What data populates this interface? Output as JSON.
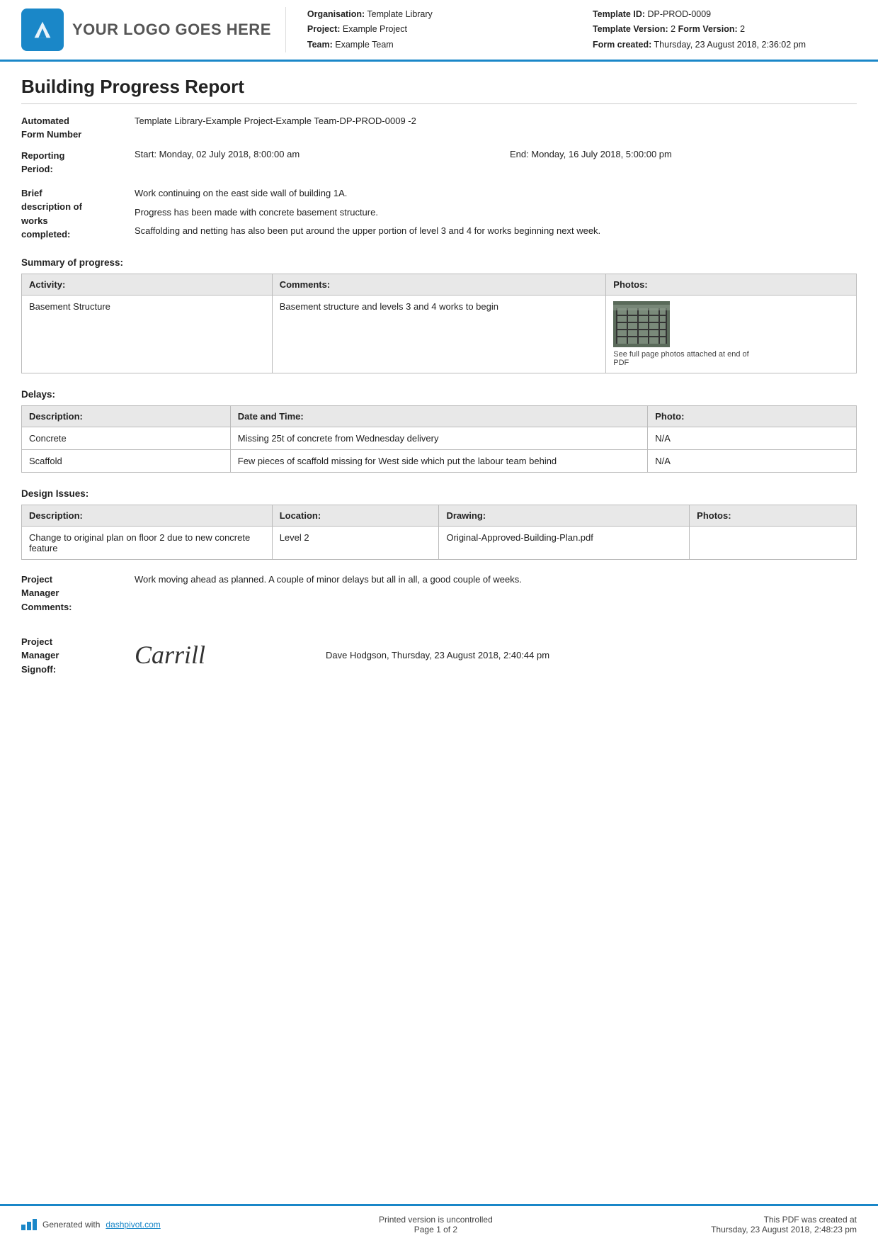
{
  "header": {
    "logo_text": "YOUR LOGO GOES HERE",
    "org_label": "Organisation:",
    "org_value": "Template Library",
    "project_label": "Project:",
    "project_value": "Example Project",
    "team_label": "Team:",
    "team_value": "Example Team",
    "template_id_label": "Template ID:",
    "template_id_value": "DP-PROD-0009",
    "template_version_label": "Template Version:",
    "template_version_value": "2",
    "form_version_label": "Form Version:",
    "form_version_value": "2",
    "form_created_label": "Form created:",
    "form_created_value": "Thursday, 23 August 2018, 2:36:02 pm"
  },
  "report": {
    "title": "Building Progress Report",
    "form_number_label": "Automated\nForm Number",
    "form_number_value": "Template Library-Example Project-Example Team-DP-PROD-0009   -2",
    "reporting_period_label": "Reporting\nPeriod:",
    "reporting_period_start": "Start: Monday, 02 July 2018, 8:00:00 am",
    "reporting_period_end": "End: Monday, 16 July 2018, 5:00:00 pm",
    "description_label": "Brief\ndescription of\nworks\ncompleted:",
    "description_lines": [
      "Work continuing on the east side wall of building 1A.",
      "Progress has been made with concrete basement structure.",
      "Scaffolding and netting has also been put around the upper portion of level 3 and 4 for works beginning next week."
    ]
  },
  "summary": {
    "section_title": "Summary of progress:",
    "table_headers": [
      "Activity:",
      "Comments:",
      "Photos:"
    ],
    "rows": [
      {
        "activity": "Basement Structure",
        "comments": "Basement structure and levels 3 and 4 works to begin",
        "photo_caption": "See full page photos attached at end of PDF"
      }
    ]
  },
  "delays": {
    "section_title": "Delays:",
    "table_headers": [
      "Description:",
      "Date and Time:",
      "Photo:"
    ],
    "rows": [
      {
        "description": "Concrete",
        "date_time": "Missing 25t of concrete from Wednesday delivery",
        "photo": "N/A"
      },
      {
        "description": "Scaffold",
        "date_time": "Few pieces of scaffold missing for West side which put the labour team behind",
        "photo": "N/A"
      }
    ]
  },
  "design_issues": {
    "section_title": "Design Issues:",
    "table_headers": [
      "Description:",
      "Location:",
      "Drawing:",
      "Photos:"
    ],
    "rows": [
      {
        "description": "Change to original plan on floor 2 due to new concrete feature",
        "location": "Level 2",
        "drawing": "Original-Approved-Building-Plan.pdf",
        "photos": ""
      }
    ]
  },
  "pm_comments": {
    "label": "Project\nManager\nComments:",
    "value": "Work moving ahead as planned. A couple of minor delays but all in all, a good couple of weeks."
  },
  "pm_signoff": {
    "label": "Project\nManager\nSignoff:",
    "name": "Dave Hodgson, Thursday, 23 August 2018, 2:40:44 pm",
    "signature": "Carrill"
  },
  "footer": {
    "generated_text": "Generated with ",
    "generated_link": "dashpivot.com",
    "uncontrolled_text": "Printed version is uncontrolled",
    "page_text": "Page 1 of 2",
    "pdf_created_label": "This PDF was created at",
    "pdf_created_value": "Thursday, 23 August 2018, 2:48:23 pm"
  }
}
